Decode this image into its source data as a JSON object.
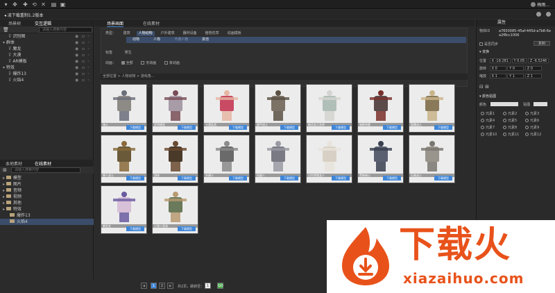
{
  "topbar": {
    "user": "梅雨..."
  },
  "subbar": {
    "breadcrumb": "凌下载重制1.2版本"
  },
  "left": {
    "tabs": [
      "场景树",
      "交互逻辑"
    ],
    "search_placeholder": "请输入搜索内容",
    "scene_items": [
      {
        "label": "识别图",
        "indent": 1
      },
      {
        "label": "群体",
        "indent": 0
      },
      {
        "label": "魔龙",
        "indent": 1
      },
      {
        "label": "大漠",
        "indent": 1
      },
      {
        "label": "AR模板",
        "indent": 1
      },
      {
        "label": "特效",
        "indent": 0
      },
      {
        "label": "爆炸13",
        "indent": 1
      },
      {
        "label": "火焰4",
        "indent": 1
      }
    ],
    "bottom_tabs": [
      "本地素材",
      "在线素材"
    ],
    "bottom_search_placeholder": "请输入搜索内容",
    "asset_items": [
      {
        "label": "模型",
        "indent": 0,
        "selected": false
      },
      {
        "label": "图片",
        "indent": 0,
        "selected": false
      },
      {
        "label": "音频",
        "indent": 0,
        "selected": false
      },
      {
        "label": "视频",
        "indent": 0,
        "selected": false
      },
      {
        "label": "其他",
        "indent": 0,
        "selected": false
      },
      {
        "label": "特效",
        "indent": 0,
        "selected": false
      },
      {
        "label": "爆炸13",
        "indent": 1,
        "selected": false
      },
      {
        "label": "火焰4",
        "indent": 1,
        "selected": true
      }
    ]
  },
  "center": {
    "tabs": [
      "场景画面",
      "在线素材"
    ],
    "filter": {
      "type_label": "类型：",
      "types": [
        "建筑",
        "人物动物",
        "户外建筑",
        "器材设备",
        "植物花草",
        "动画模板"
      ],
      "subtypes": [
        "动物",
        "人物",
        "卡通人物",
        "其他"
      ],
      "tag_label": "标签",
      "tag_value": "男生",
      "anim_label": "动画：",
      "anim_options": [
        "全部",
        "无动画",
        "有动画"
      ]
    },
    "breadcrumb": "全部位置 > 人物动物 > 游戏角...",
    "download_label": "下载模型",
    "cards": [
      {
        "name": "骑士"
      },
      {
        "name": "武将模型"
      },
      {
        "name": "卡通女孩"
      },
      {
        "name": "重甲战士"
      },
      {
        "name": "精灵女王巫师"
      },
      {
        "name": "暗影刺客"
      },
      {
        "name": "骷髅战士"
      },
      {
        "name": "兽人战士"
      },
      {
        "name": "游侠"
      },
      {
        "name": "木偶人"
      },
      {
        "name": "机器人"
      },
      {
        "name": "白色骨骼龙人"
      },
      {
        "name": "黑暗骑士"
      },
      {
        "name": "石像战士"
      },
      {
        "name": "紫发女"
      },
      {
        "name": "小猎人男孩"
      }
    ],
    "pager": {
      "page1": "1",
      "page2": "2",
      "total": "共2页，跳转至：",
      "input": "1",
      "go": "GO"
    }
  },
  "right": {
    "title": "属性",
    "id_label": "物体ID",
    "id_value": "a7650085-45af-445d-a7b8-6ea2f8cc1006",
    "sync_label": "是否同步",
    "copy_label": "复制",
    "transform_title": "变换",
    "pos_label": "位置",
    "pos": [
      "X -19.281",
      "Y 0.05",
      "Z -6.5246"
    ],
    "rot_label": "旋转",
    "rot": [
      "X 0",
      "Y 0",
      "Z 0"
    ],
    "scale_label": "缩放",
    "scale": [
      "X 1",
      "Y 1",
      "Z 1"
    ],
    "color_title": "颜色贴图",
    "color_label": "颜色",
    "color_extra": "贴图",
    "elements": [
      "元素1",
      "元素2",
      "元素3",
      "元素4",
      "元素5",
      "元素6",
      "元素7",
      "元素8",
      "元素9",
      "元素10",
      "元素11",
      "元素12"
    ]
  },
  "ad": {
    "title": "下载火",
    "url": "xiazaihuo.com"
  },
  "colors": {
    "accent": "#3f86d8",
    "selection": "#3b4d6a",
    "brand": "#e8521a"
  }
}
